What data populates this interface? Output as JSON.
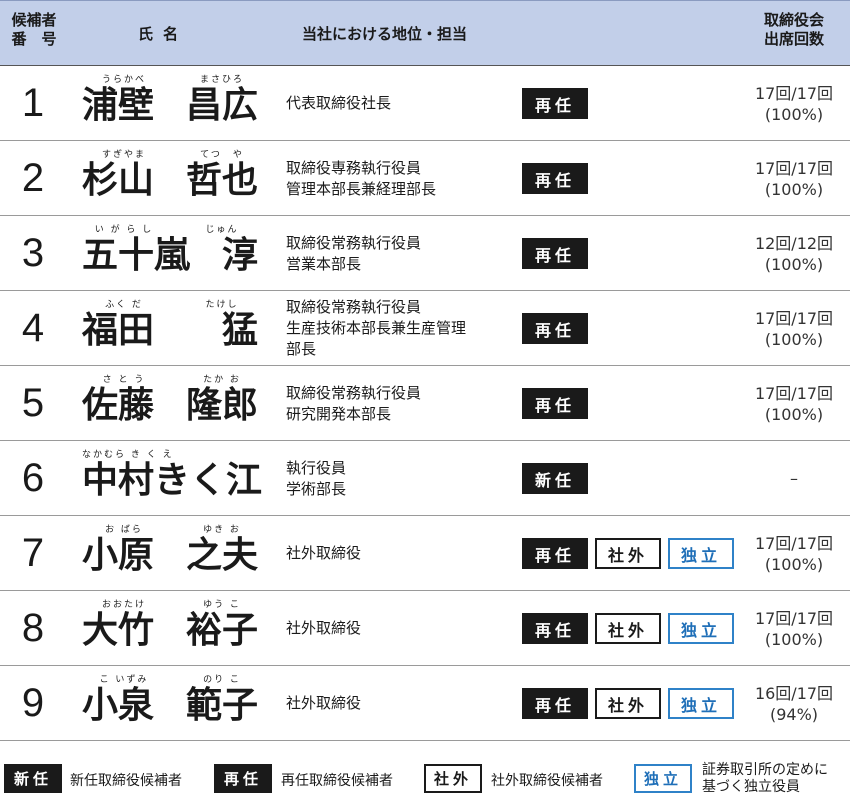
{
  "header": {
    "number": [
      "候補者",
      "番　号"
    ],
    "name": "氏名",
    "position": "当社における地位・担当",
    "attendance": [
      "取締役会",
      "出席回数"
    ]
  },
  "candidates": [
    {
      "no": "1",
      "family": "浦壁",
      "given": "昌広",
      "family_ruby": "うらかべ",
      "given_ruby": "まさひろ",
      "position": [
        "代表取締役社長"
      ],
      "badges": [
        "再任"
      ],
      "attendance": [
        "17回/17回",
        "(100%)"
      ]
    },
    {
      "no": "2",
      "family": "杉山",
      "given": "哲也",
      "family_ruby": "すぎやま",
      "given_ruby": "てつ　や",
      "position": [
        "取締役専務執行役員",
        "管理本部長兼経理部長"
      ],
      "badges": [
        "再任"
      ],
      "attendance": [
        "17回/17回",
        "(100%)"
      ]
    },
    {
      "no": "3",
      "family": "五十嵐",
      "given": "淳",
      "family_ruby": "い が ら し",
      "given_ruby": "じゅん",
      "position": [
        "取締役常務執行役員",
        "営業本部長"
      ],
      "badges": [
        "再任"
      ],
      "attendance": [
        "12回/12回",
        "(100%)"
      ]
    },
    {
      "no": "4",
      "family": "福田",
      "given": "猛",
      "family_ruby": "ふく だ",
      "given_ruby": "たけし",
      "position": [
        "取締役常務執行役員",
        "生産技術本部長兼生産管理",
        "部長"
      ],
      "badges": [
        "再任"
      ],
      "attendance": [
        "17回/17回",
        "(100%)"
      ]
    },
    {
      "no": "5",
      "family": "佐藤",
      "given": "隆郎",
      "family_ruby": "さ と う",
      "given_ruby": "たか お",
      "position": [
        "取締役常務執行役員",
        "研究開発本部長"
      ],
      "badges": [
        "再任"
      ],
      "attendance": [
        "17回/17回",
        "(100%)"
      ]
    },
    {
      "no": "6",
      "full": "中村きく江",
      "full_ruby": "なかむら き く え",
      "position": [
        "執行役員",
        "学術部長"
      ],
      "badges": [
        "新任"
      ],
      "attendance": [
        "–"
      ]
    },
    {
      "no": "7",
      "family": "小原",
      "given": "之夫",
      "family_ruby": "お ばら",
      "given_ruby": "ゆき お",
      "position": [
        "社外取締役"
      ],
      "badges": [
        "再任",
        "社外",
        "独立"
      ],
      "attendance": [
        "17回/17回",
        "(100%)"
      ]
    },
    {
      "no": "8",
      "family": "大竹",
      "given": "裕子",
      "family_ruby": "おおたけ",
      "given_ruby": "ゆう こ",
      "position": [
        "社外取締役"
      ],
      "badges": [
        "再任",
        "社外",
        "独立"
      ],
      "attendance": [
        "17回/17回",
        "(100%)"
      ]
    },
    {
      "no": "9",
      "family": "小泉",
      "given": "範子",
      "family_ruby": "こ いずみ",
      "given_ruby": "のり こ",
      "position": [
        "社外取締役"
      ],
      "badges": [
        "再任",
        "社外",
        "独立"
      ],
      "attendance": [
        "16回/17回",
        "(94%)"
      ]
    }
  ],
  "legend": {
    "new_badge": "新任",
    "new_text": "新任取締役候補者",
    "re_badge": "再任",
    "re_text": "再任取締役候補者",
    "out_badge": "社外",
    "out_text": "社外取締役候補者",
    "ind_badge": "独立",
    "ind_text": [
      "証券取引所の定めに",
      "基づく独立役員"
    ]
  },
  "colors": {
    "header_bg": "#c2cfe9",
    "independent_blue": "#2f82c8",
    "badge_dark": "#1a1a1a"
  }
}
